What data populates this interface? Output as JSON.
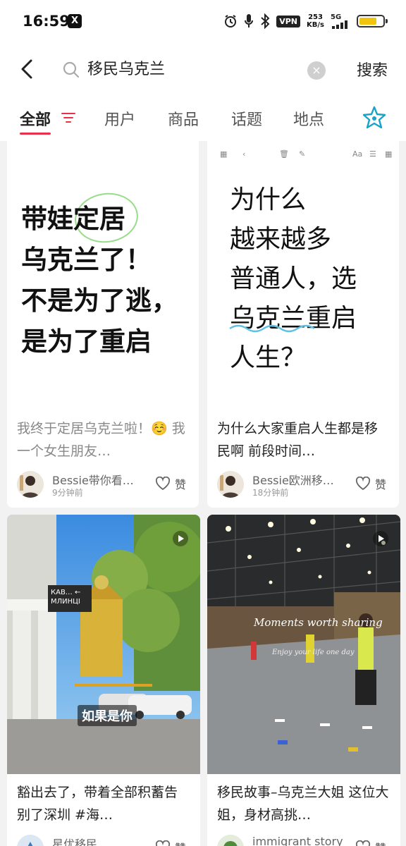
{
  "status_bar": {
    "time": "16:59",
    "x_app_badge": "X",
    "vpn": "VPN",
    "net_speed_value": "253",
    "net_speed_unit": "KB/s",
    "network": "5G",
    "battery_level": 0.75,
    "icons": [
      "alarm-icon",
      "microphone-icon",
      "bluetooth-icon",
      "signal-icon",
      "battery-icon"
    ]
  },
  "search": {
    "query": "移民乌克兰",
    "clear_icon": "×",
    "submit_label": "搜索"
  },
  "tabs": [
    {
      "label": "全部",
      "active": true
    },
    {
      "label": "用户",
      "active": false
    },
    {
      "label": "商品",
      "active": false
    },
    {
      "label": "话题",
      "active": false
    },
    {
      "label": "地点",
      "active": false
    }
  ],
  "accent_color": "#e8304a",
  "cards": [
    {
      "cover_lines": [
        "带娃定居",
        "乌克兰了！",
        "不是为了逃，",
        "是为了重启"
      ],
      "title": "我终于定居乌克兰啦！☺️ 我一个女生朋友…",
      "author": "Bessie带你看…",
      "time": "9分钟前",
      "like_label": "赞"
    },
    {
      "cover_lines": [
        "为什么",
        "越来越多",
        "普通人，选",
        "乌克兰重启",
        "人生？"
      ],
      "title": "为什么大家重启人生都是移民啊 前段时间…",
      "author": "Bessie欧洲移…",
      "time": "18分钟前",
      "like_label": "赞"
    },
    {
      "photo_sign": "КАВ… ← МЛИНЦІ",
      "photo_caption": "如果是你",
      "title": "豁出去了，带着全部积蓄告别了深圳 #海…",
      "author": "星优移民",
      "like_label": "赞"
    },
    {
      "photo_script": "Moments worth sharing",
      "photo_script_small": "Enjoy your life one day",
      "title": "移民故事–乌克兰大姐 这位大姐，身材高挑…",
      "author": "immigrant story",
      "like_label": "赞"
    }
  ]
}
